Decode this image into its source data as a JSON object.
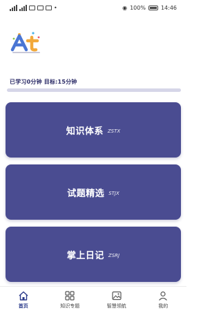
{
  "status_bar": {
    "battery": "100%",
    "time": "14:46"
  },
  "progress": {
    "text": "已学习0分钟 目标:15分钟",
    "learned_minutes": 0,
    "target_minutes": 15
  },
  "cards": [
    {
      "title": "知识体系",
      "code": "ZSTX"
    },
    {
      "title": "试题精选",
      "code": "STJX"
    },
    {
      "title": "掌上日记",
      "code": "ZSRJ"
    }
  ],
  "tabs": [
    {
      "label": "首页",
      "icon": "home-icon",
      "active": true
    },
    {
      "label": "知识专题",
      "icon": "grid-icon",
      "active": false
    },
    {
      "label": "智慧领航",
      "icon": "image-icon",
      "active": false
    },
    {
      "label": "我的",
      "icon": "user-icon",
      "active": false
    }
  ],
  "colors": {
    "card": "#4a4c91",
    "accent": "#2a3a8a",
    "progress_track": "#d6d6e8"
  }
}
